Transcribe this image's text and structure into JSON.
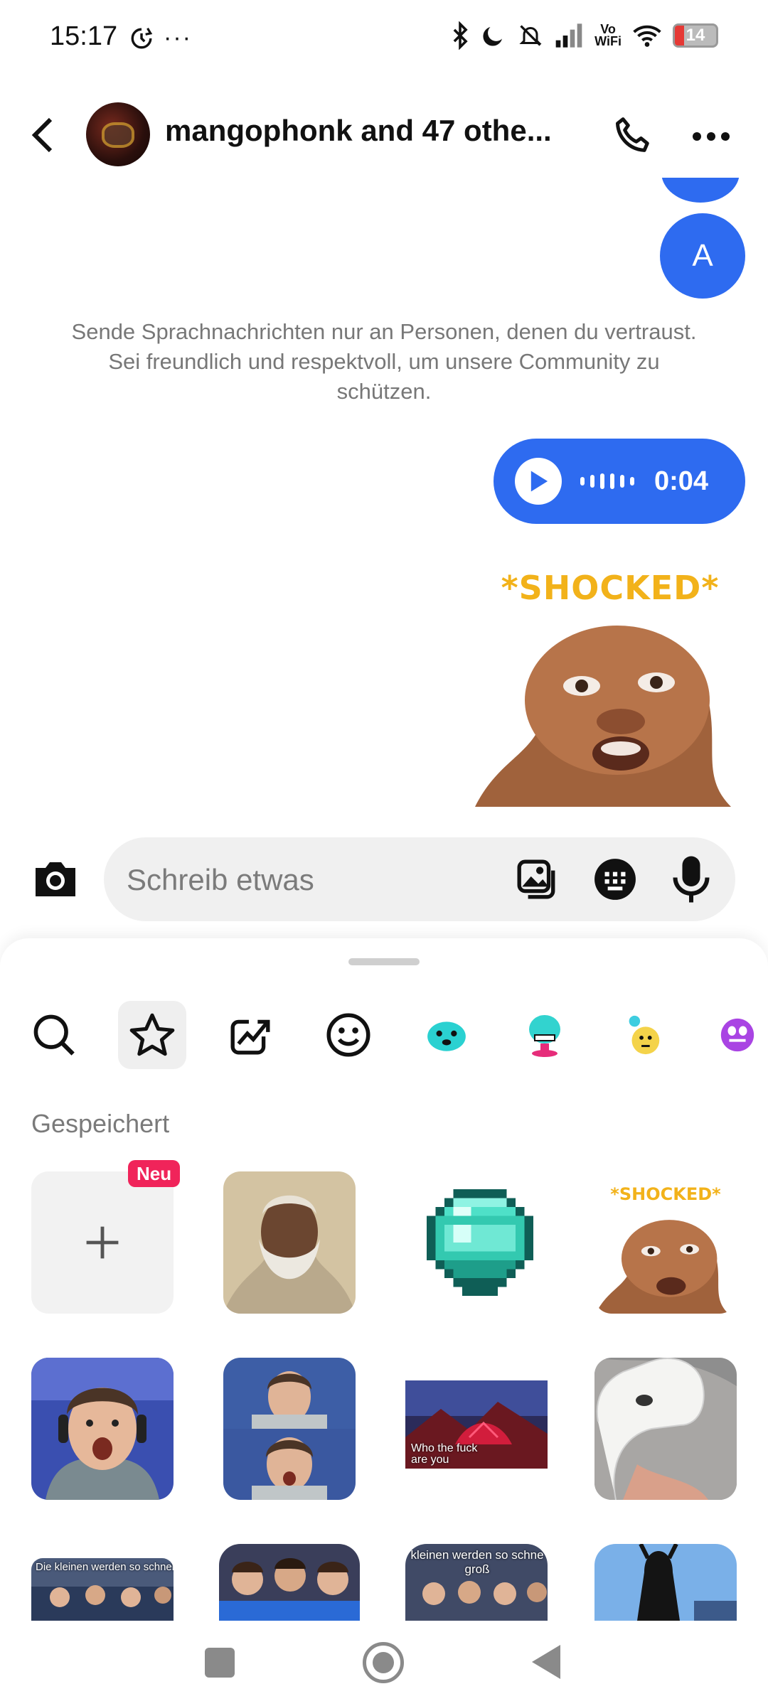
{
  "status_bar": {
    "time": "15:17",
    "more_indicator": "···",
    "vowifi_line1": "Vo",
    "vowifi_line2": "WiFi",
    "battery_level": "14",
    "battery_color": "#e53935"
  },
  "header": {
    "title": "mangophonk and 47 othe..."
  },
  "chat": {
    "avatar_letter": "A",
    "notice": "Sende Sprachnachrichten nur an Personen, denen du vertraust. Sei freundlich und respektvoll, um unsere Community zu schützen.",
    "voice_message": {
      "duration": "0:04"
    },
    "sticker_caption": "*SHOCKED*",
    "accent_color": "#2e6bf0"
  },
  "composer": {
    "placeholder": "Schreib etwas"
  },
  "sticker_panel": {
    "tabs": [
      "search-icon",
      "star-icon",
      "trending-icon",
      "smiley-icon",
      "sticker-pack-1",
      "sticker-pack-2",
      "sticker-pack-3",
      "sticker-pack-4"
    ],
    "section_title": "Gespeichert",
    "new_badge": "Neu",
    "shocked_label": "*SHOCKED*",
    "captions": {
      "volcano": "Who the fuck are you",
      "kids_1": "Die kleinen werden so schnell groß",
      "kids_2": "kleinen werden so schne groß"
    }
  }
}
